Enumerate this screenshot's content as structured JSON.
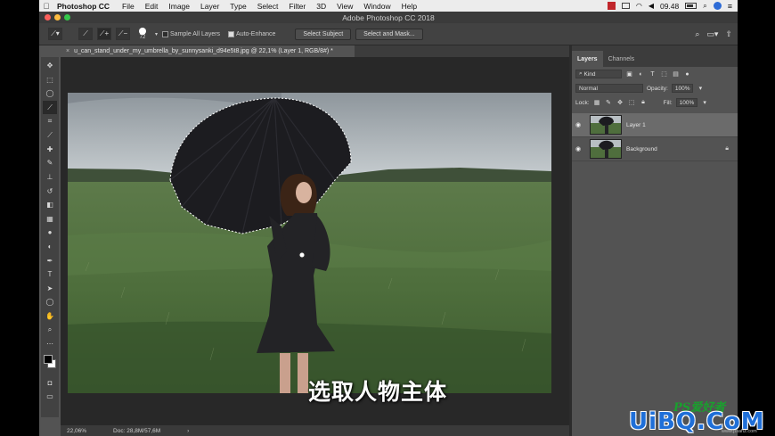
{
  "menubar": {
    "app": "Photoshop CC",
    "items": [
      "File",
      "Edit",
      "Image",
      "Layer",
      "Type",
      "Select",
      "Filter",
      "3D",
      "View",
      "Window",
      "Help"
    ],
    "clock": "09.48"
  },
  "window": {
    "title": "Adobe Photoshop CC 2018"
  },
  "options": {
    "brush_size": "72",
    "sample_all_layers": "Sample All Layers",
    "auto_enhance": "Auto-Enhance",
    "select_subject": "Select Subject",
    "select_and_mask": "Select and Mask..."
  },
  "document": {
    "tab_title": "u_can_stand_under_my_umbrella_by_sunnysanki_d94e5t8.jpg @ 22,1% (Layer 1, RGB/8#) *",
    "close_glyph": "×"
  },
  "status": {
    "zoom": "22,06%",
    "doc": "Doc: 28,8M/57,6M",
    "arrow": "›"
  },
  "subtitle": "选取人物主体",
  "panel": {
    "tabs": [
      "Layers",
      "Channels"
    ],
    "kind_label": "Kind",
    "blend_mode": "Normal",
    "opacity_label": "Opacity:",
    "opacity_value": "100%",
    "lock_label": "Lock:",
    "fill_label": "Fill:",
    "fill_value": "100%",
    "layers": [
      {
        "name": "Layer 1",
        "selected": true
      },
      {
        "name": "Background",
        "selected": false
      }
    ]
  },
  "watermark": {
    "top": "PS爱好者",
    "main": "UiBQ.CoM",
    "sub": "www.psahz.com"
  },
  "colors": {
    "ui_bg": "#535353",
    "canvas_bg": "#282828",
    "watermark_blue": "#1f6fd8",
    "watermark_green": "#1aa02e"
  }
}
